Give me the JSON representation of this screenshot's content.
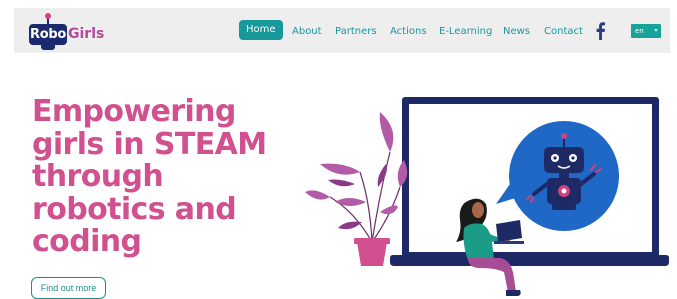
{
  "logo": {
    "robo": "Robo",
    "girls": "Girls"
  },
  "nav": {
    "items": [
      {
        "label": "Home",
        "active": true
      },
      {
        "label": "About",
        "active": false
      },
      {
        "label": "Partners",
        "active": false
      },
      {
        "label": "Actions",
        "active": false
      },
      {
        "label": "E-Learning",
        "active": false
      },
      {
        "label": "News",
        "active": false
      },
      {
        "label": "Contact",
        "active": false
      }
    ],
    "social_icon": "facebook-icon",
    "language": "en"
  },
  "hero": {
    "title": "Empowering girls in STEAM through robotics and coding",
    "cta_label": "Find out more"
  },
  "colors": {
    "accent_teal": "#17999a",
    "brand_pink": "#d1508f",
    "brand_navy": "#1b2a6e",
    "navbar_bg": "#eeeeef"
  }
}
